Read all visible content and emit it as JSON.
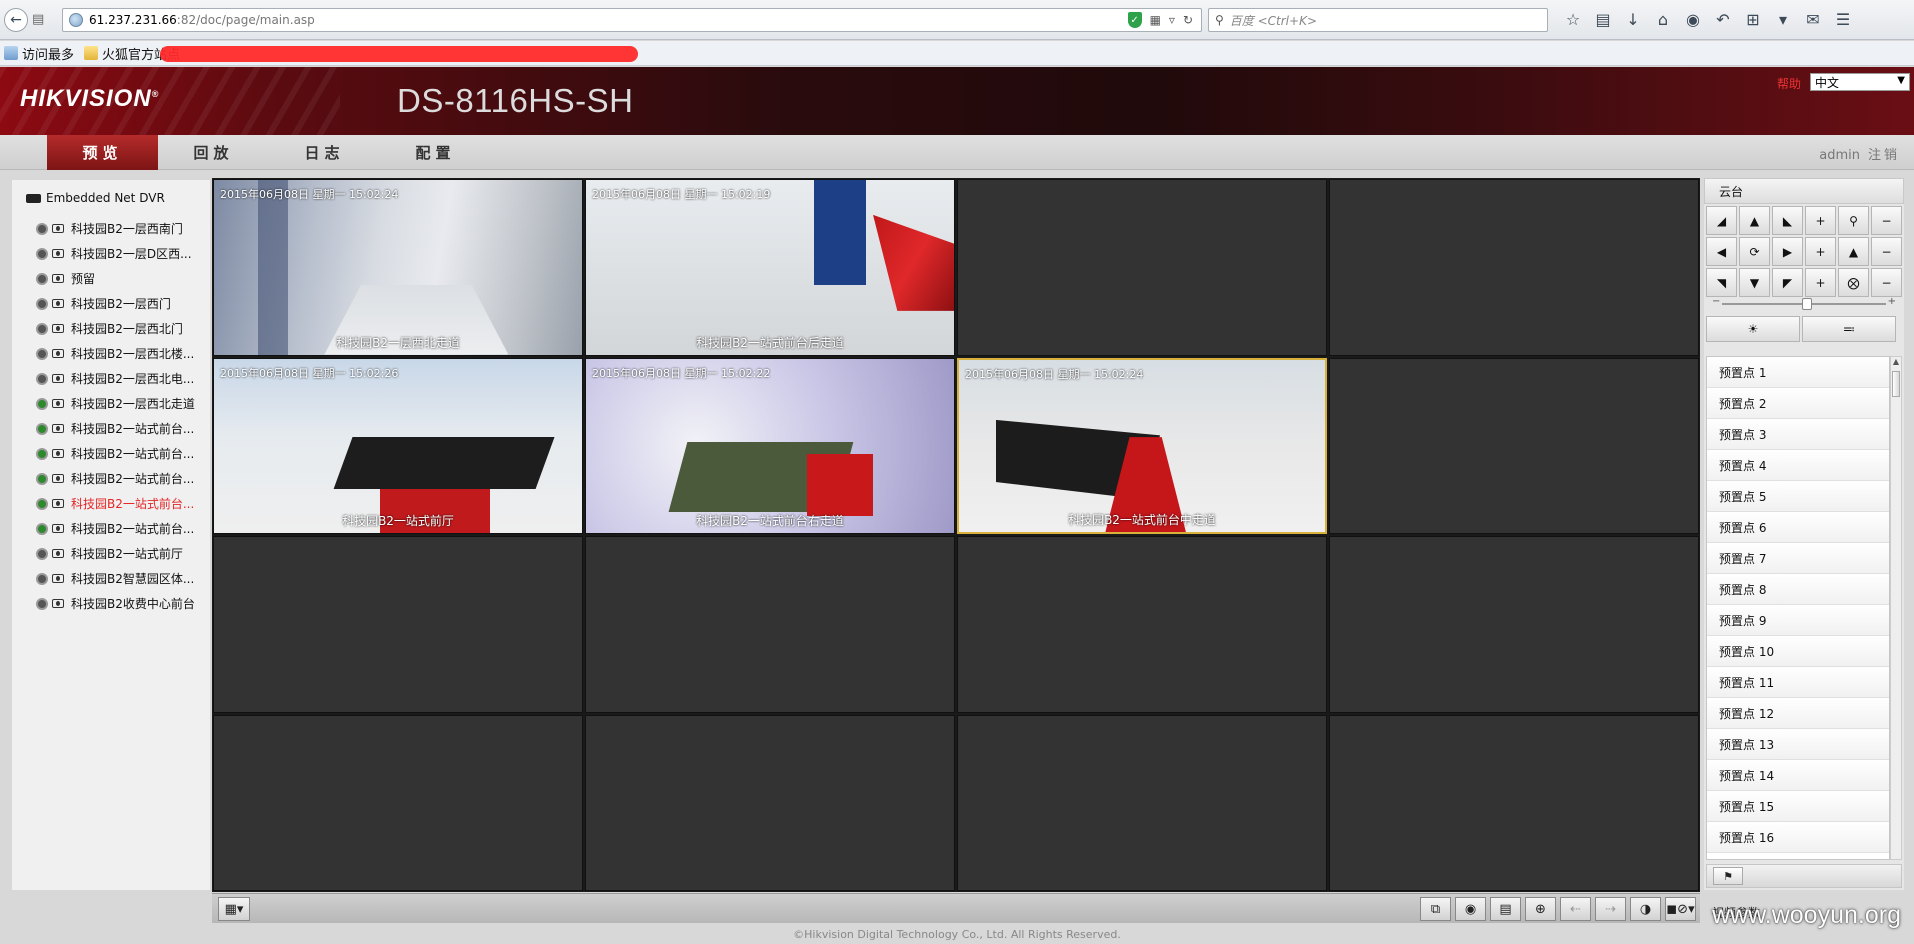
{
  "browser": {
    "url_host": "61.237.231.66",
    "url_path": ":82/doc/page/main.asp",
    "search_placeholder": "百度 <Ctrl+K>",
    "bookmarks": [
      {
        "label": "访问最多"
      },
      {
        "label": "火狐官方站点"
      }
    ]
  },
  "banner": {
    "logo": "HIKVISION",
    "model": "DS-8116HS-SH",
    "help": "帮助",
    "language": "中文"
  },
  "nav": {
    "tabs": [
      {
        "label": "预览"
      },
      {
        "label": "回放"
      },
      {
        "label": "日志"
      },
      {
        "label": "配置"
      }
    ],
    "user": "admin",
    "logout": "注销"
  },
  "tree": {
    "root": "Embedded Net DVR",
    "items": [
      {
        "label": "科技园B2一层西南门"
      },
      {
        "label": "科技园B2一层D区西..."
      },
      {
        "label": "预留"
      },
      {
        "label": "科技园B2一层西门"
      },
      {
        "label": "科技园B2一层西北门"
      },
      {
        "label": "科技园B2一层西北楼..."
      },
      {
        "label": "科技园B2一层西北电..."
      },
      {
        "label": "科技园B2一层西北走道"
      },
      {
        "label": "科技园B2一站式前台..."
      },
      {
        "label": "科技园B2一站式前台..."
      },
      {
        "label": "科技园B2一站式前台..."
      },
      {
        "label": "科技园B2一站式前台..."
      },
      {
        "label": "科技园B2一站式前台..."
      },
      {
        "label": "科技园B2一站式前厅"
      },
      {
        "label": "科技园B2智慧园区体..."
      },
      {
        "label": "科技园B2收费中心前台"
      }
    ]
  },
  "feeds": [
    {
      "time": "2015年06月08日 星期一 15:02:24",
      "name": "科技园B2一层西北走道"
    },
    {
      "time": "2015年06月08日 星期一 15:02:19",
      "name": "科技园B2一站式前台后走道"
    },
    {
      "time": "2015年06月08日 星期一 15:02:26",
      "name": "科技园B2一站式前厅"
    },
    {
      "time": "2015年06月08日 星期一 15:02:22",
      "name": "科技园B2一站式前台右走道"
    },
    {
      "time": "2015年06月08日 星期一 15:02:24",
      "name": "科技园B2一站式前台中走道"
    }
  ],
  "ptz": {
    "title": "云台",
    "presets": [
      "预置点 1",
      "预置点 2",
      "预置点 3",
      "预置点 4",
      "预置点 5",
      "预置点 6",
      "预置点 7",
      "预置点 8",
      "预置点 9",
      "预置点 10",
      "预置点 11",
      "预置点 12",
      "预置点 13",
      "预置点 14",
      "预置点 15",
      "预置点 16"
    ],
    "bottom_label": "视频参数"
  },
  "footer": "©Hikvision Digital Technology Co., Ltd. All Rights Reserved.",
  "watermark": "www.wooyun.org"
}
